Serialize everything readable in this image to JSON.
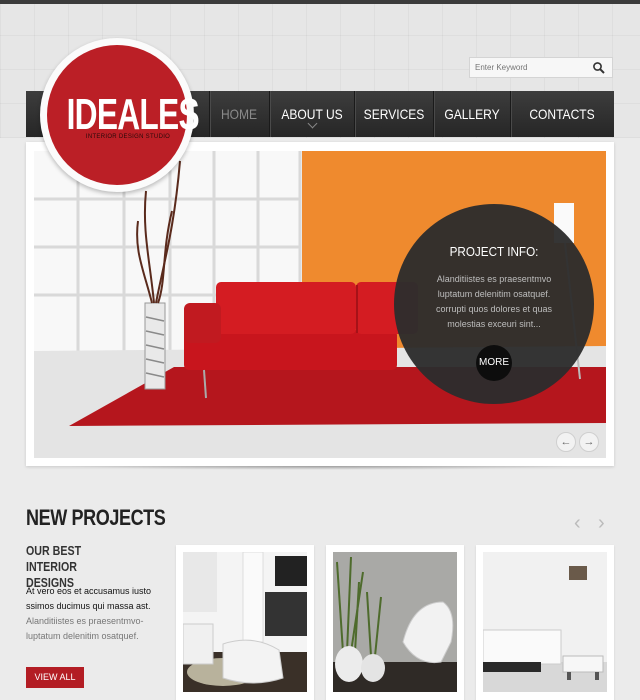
{
  "brand": {
    "name": "IDEALES",
    "tagline": "INTERIOR DESIGN STUDIO"
  },
  "search": {
    "placeholder": "Enter Keyword",
    "icon": "search-icon"
  },
  "nav": {
    "items": [
      {
        "label": "HOME",
        "active": true
      },
      {
        "label": "ABOUT US",
        "active": false
      },
      {
        "label": "SERVICES",
        "active": false
      },
      {
        "label": "GALLERY",
        "active": false
      },
      {
        "label": "CONTACTS",
        "active": false
      }
    ]
  },
  "slider": {
    "info_title": "PROJECT INFO:",
    "info_text": "Alanditiistes es praesentmvo luptatum delenitim osatquef. corrupti quos dolores et quas molestias exceuri sint...",
    "more_label": "MORE",
    "prev_icon": "arrow-left-icon",
    "next_icon": "arrow-right-icon"
  },
  "projects": {
    "title": "NEW PROJECTS",
    "subtitle": "OUR BEST INTERIOR DESIGNS",
    "text_primary": "At vero eos et accusamus iusto ssimos ducimus qui massa ast.",
    "text_secondary": "Alanditiistes es praesentmvo-luptatum delenitim osatquef.",
    "view_all_label": "VIEW ALL"
  },
  "colors": {
    "accent": "#bb1f26",
    "nav_bg": "#2e2e2e",
    "wall": "#ef8a2e"
  }
}
